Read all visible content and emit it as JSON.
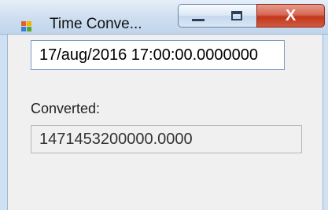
{
  "window": {
    "title": "Time Conve...",
    "icon": "windows-form-icon",
    "controls": {
      "minimize": "minimize-icon",
      "maximize": "maximize-icon",
      "close": "close-icon",
      "close_glyph": "X"
    }
  },
  "form": {
    "input_value": "17/aug/2016 17:00:00.0000000",
    "converted_label": "Converted:",
    "converted_value": "1471453200000.0000"
  }
}
